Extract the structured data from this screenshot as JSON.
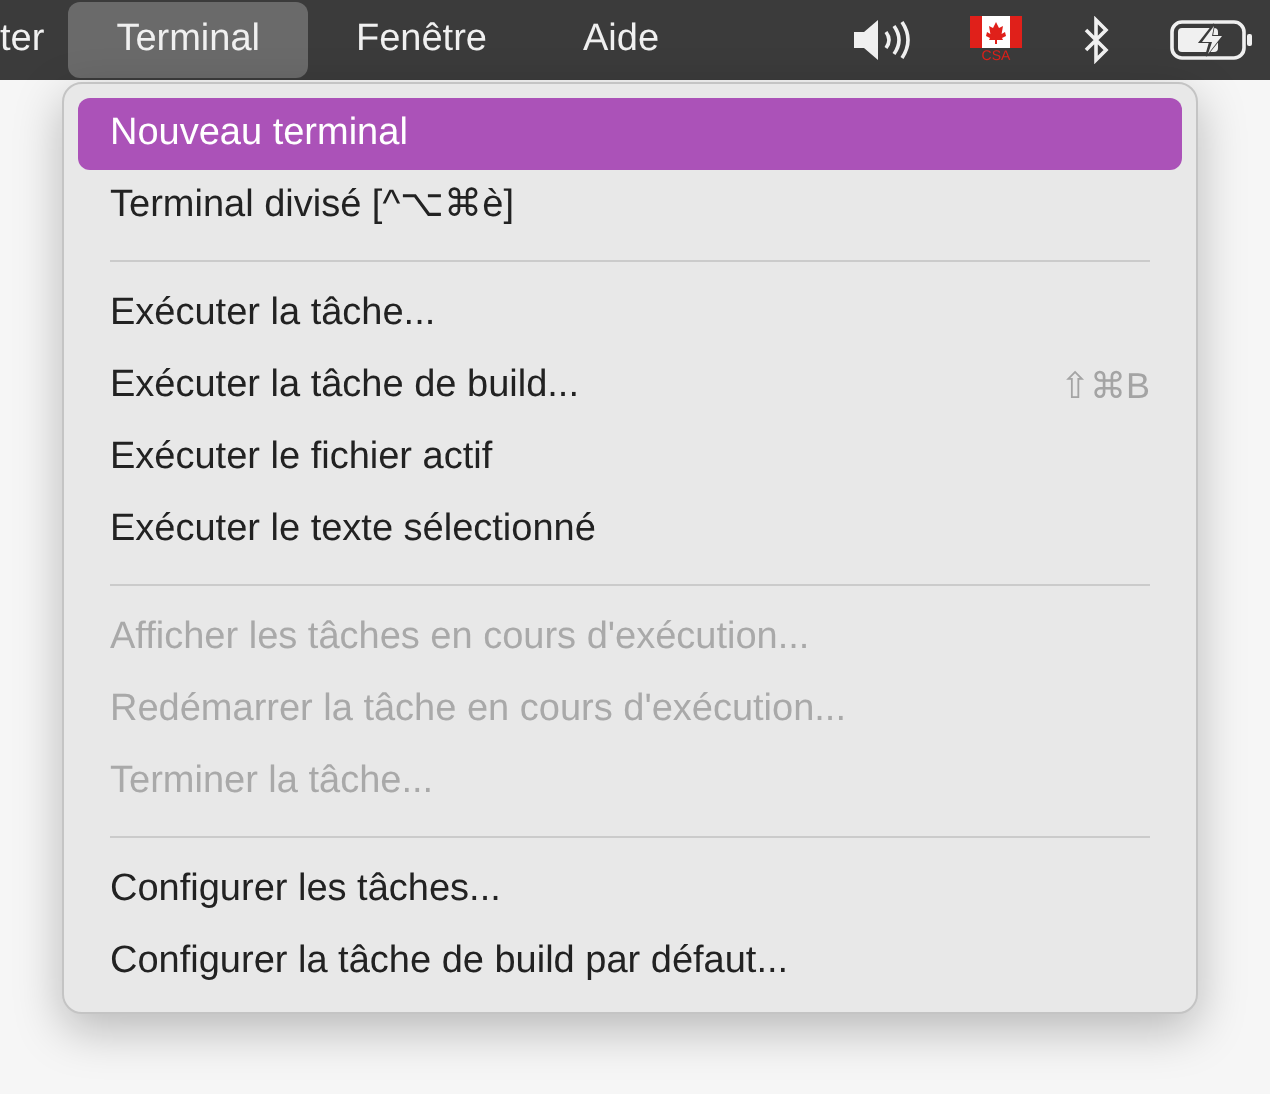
{
  "menu_bar": {
    "items": [
      {
        "label": "ter",
        "selected": false
      },
      {
        "label": "Terminal",
        "selected": true
      },
      {
        "label": "Fenêtre",
        "selected": false
      },
      {
        "label": "Aide",
        "selected": false
      }
    ],
    "flag_caption": "CSA"
  },
  "menu": {
    "entries": [
      {
        "kind": "item",
        "label": "Nouveau terminal",
        "selected": true,
        "disabled": false
      },
      {
        "kind": "item",
        "label": "Terminal divisé [^⌥⌘è]",
        "selected": false,
        "disabled": false
      },
      {
        "kind": "separator"
      },
      {
        "kind": "item",
        "label": "Exécuter la tâche...",
        "selected": false,
        "disabled": false
      },
      {
        "kind": "item",
        "label": "Exécuter la tâche de build...",
        "shortcut": "⇧⌘B",
        "selected": false,
        "disabled": false
      },
      {
        "kind": "item",
        "label": "Exécuter le fichier actif",
        "selected": false,
        "disabled": false
      },
      {
        "kind": "item",
        "label": "Exécuter le texte sélectionné",
        "selected": false,
        "disabled": false
      },
      {
        "kind": "separator"
      },
      {
        "kind": "item",
        "label": "Afficher les tâches en cours d'exécution...",
        "selected": false,
        "disabled": true
      },
      {
        "kind": "item",
        "label": "Redémarrer la tâche en cours d'exécution...",
        "selected": false,
        "disabled": true
      },
      {
        "kind": "item",
        "label": "Terminer la tâche...",
        "selected": false,
        "disabled": true
      },
      {
        "kind": "separator"
      },
      {
        "kind": "item",
        "label": "Configurer les tâches...",
        "selected": false,
        "disabled": false
      },
      {
        "kind": "item",
        "label": "Configurer la tâche de build par défaut...",
        "selected": false,
        "disabled": false
      }
    ]
  }
}
